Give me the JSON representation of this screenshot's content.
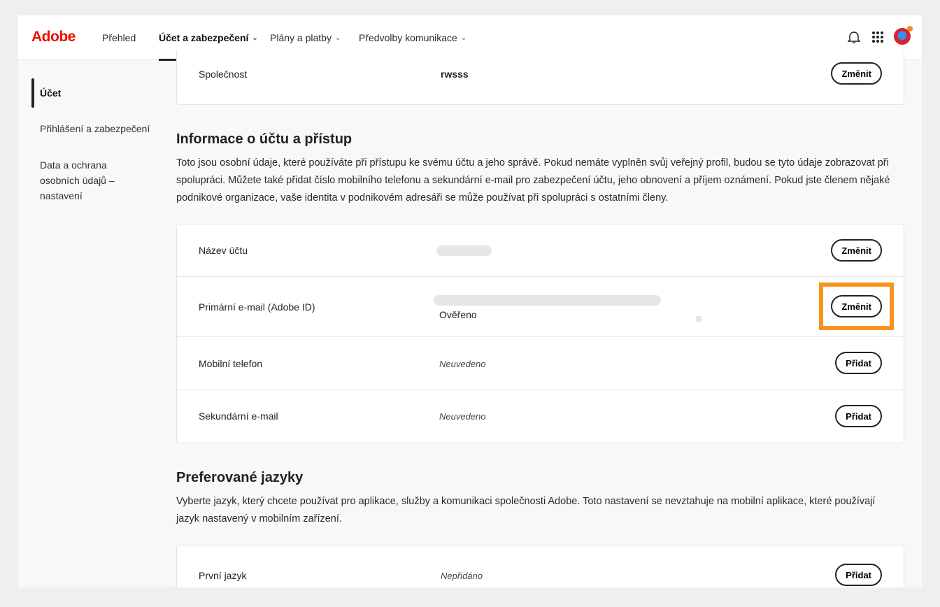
{
  "header": {
    "logo": "Adobe",
    "nav": [
      {
        "label": "Přehled",
        "dropdown": false
      },
      {
        "label": "Účet a zabezpečení",
        "dropdown": true,
        "active": true
      },
      {
        "label": "Plány a platby",
        "dropdown": true
      },
      {
        "label": "Předvolby komunikace",
        "dropdown": true
      }
    ],
    "icons": [
      "bell-icon",
      "apps-grid-icon",
      "avatar"
    ]
  },
  "sidebar": {
    "items": [
      {
        "label": "Účet",
        "active": true
      },
      {
        "label": "Přihlášení a zabezpečení"
      },
      {
        "label": "Data a ochrana osobních údajů – nastavení"
      }
    ]
  },
  "company": {
    "label": "Společnost",
    "value": "rwsss",
    "button": "Změnit"
  },
  "account_section": {
    "title": "Informace o účtu a přístup",
    "description": "Toto jsou osobní údaje, které používáte při přístupu ke svému účtu a jeho správě. Pokud nemáte vyplněn svůj veřejný profil, budou se tyto údaje zobrazovat při spolupráci. Můžete také přidat číslo mobilního telefonu a sekundární e-mail pro zabezpečení účtu, jeho obnovení a příjem oznámení. Pokud jste členem nějaké podnikové organizace, vaše identita v podnikovém adresáři se může používat při spolupráci s ostatními členy.",
    "rows": [
      {
        "label": "Název účtu",
        "button": "Změnit"
      },
      {
        "label": "Primární e-mail (Adobe ID)",
        "status": "Ověřeno",
        "button": "Změnit"
      },
      {
        "label": "Mobilní telefon",
        "value": "Neuvedeno",
        "button": "Přidat"
      },
      {
        "label": "Sekundární e-mail",
        "value": "Neuvedeno",
        "button": "Přidat"
      }
    ]
  },
  "language_section": {
    "title": "Preferované jazyky",
    "description": "Vyberte jazyk, který chcete používat pro aplikace, služby a komunikaci společnosti Adobe. Toto nastavení se nevztahuje na mobilní aplikace, které používají jazyk nastavený v mobilním zařízení.",
    "rows": [
      {
        "label": "První jazyk",
        "value": "Nepřidáno",
        "button": "Přidat"
      }
    ]
  },
  "colors": {
    "brand": "#eb1000",
    "highlight": "#f7941d"
  }
}
